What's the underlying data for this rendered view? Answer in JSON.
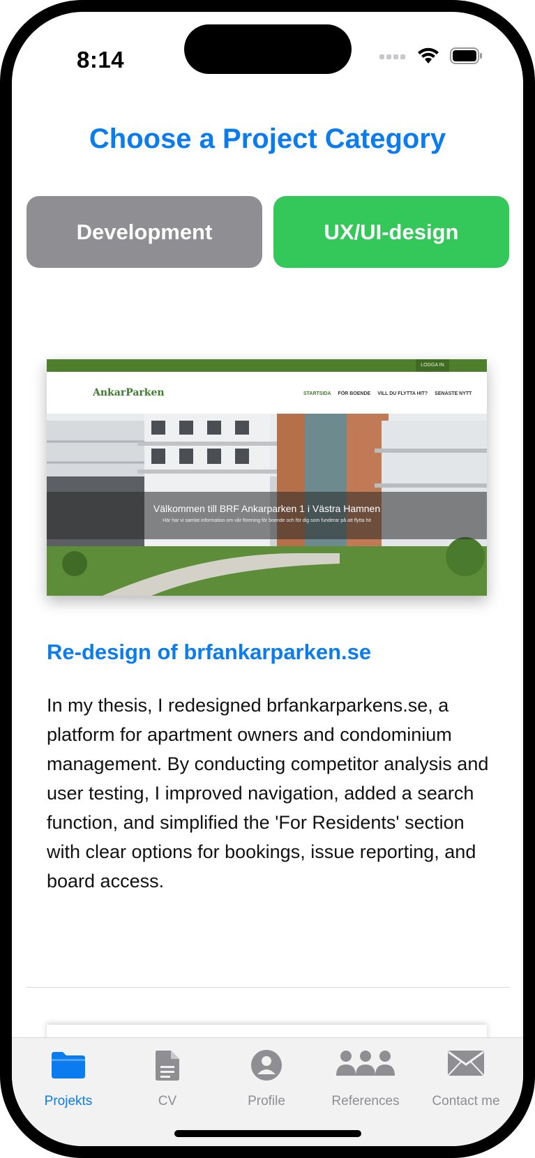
{
  "status": {
    "time": "8:14"
  },
  "header": {
    "title": "Choose a Project Category"
  },
  "categories": [
    {
      "label": "Development",
      "selected": false,
      "color": "#8e8e93"
    },
    {
      "label": "UX/UI-design",
      "selected": true,
      "color": "#34c759"
    }
  ],
  "project": {
    "screenshot": {
      "login": "LOGGA IN",
      "logo": "AnkarParken",
      "nav": [
        "STARTSIDA",
        "FÖR BOENDE",
        "VILL DU FLYTTA HIT?",
        "SENASTE NYTT"
      ],
      "hero_title": "Välkommen till BRF Ankarparken 1 i Västra Hamnen",
      "hero_sub": "Här har vi samlat information om vår förening för boende och för dig som funderar på att flytta hit"
    },
    "title": "Re-design of brfankarparken.se",
    "description": "In my thesis, I redesigned brfankarparkens.se, a platform for apartment owners and condominium management. By conducting competitor analysis and user testing, I improved navigation, added a search function, and simplified the 'For Residents' section with clear options for bookings, issue reporting, and board access."
  },
  "tabs": [
    {
      "label": "Projekts",
      "icon": "folder-icon",
      "active": true
    },
    {
      "label": "CV",
      "icon": "document-icon",
      "active": false
    },
    {
      "label": "Profile",
      "icon": "person-icon",
      "active": false
    },
    {
      "label": "References",
      "icon": "people-icon",
      "active": false
    },
    {
      "label": "Contact me",
      "icon": "envelope-icon",
      "active": false
    }
  ],
  "colors": {
    "accent": "#0a7cf0",
    "inactive": "#8e8e93",
    "selected_category": "#34c759"
  }
}
